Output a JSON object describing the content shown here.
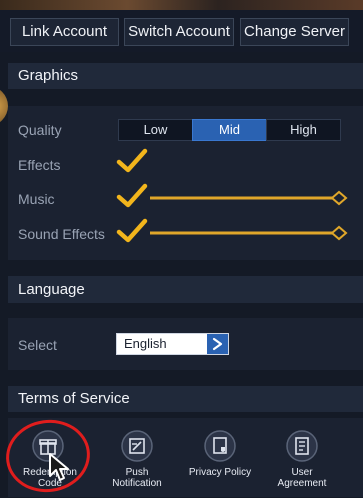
{
  "account": {
    "link_label": "Link Account",
    "switch_label": "Switch Account",
    "change_server_label": "Change Server"
  },
  "graphics": {
    "title": "Graphics",
    "quality_label": "Quality",
    "quality_options": [
      "Low",
      "Mid",
      "High"
    ],
    "quality_selected": "Mid",
    "effects_label": "Effects",
    "effects_checked": true,
    "music_label": "Music",
    "music_checked": true,
    "music_volume": 1.0,
    "sound_effects_label": "Sound Effects",
    "sound_effects_checked": true,
    "sound_effects_volume": 1.0
  },
  "language": {
    "title": "Language",
    "select_label": "Select",
    "selected_value": "English"
  },
  "terms": {
    "title": "Terms of Service",
    "items": [
      {
        "label_line1": "Redemption",
        "label_line2": "Code",
        "icon": "gift-icon"
      },
      {
        "label_line1": "Push",
        "label_line2": "Notification",
        "icon": "notification-icon"
      },
      {
        "label_line1": "Privacy Policy",
        "label_line2": "",
        "icon": "shield-icon"
      },
      {
        "label_line1": "User",
        "label_line2": "Agreement",
        "icon": "document-icon"
      }
    ]
  },
  "colors": {
    "accent": "#2a62b2",
    "check": "#f2b51c",
    "slider": "#e0a72a",
    "annotation": "#e01d1d"
  }
}
